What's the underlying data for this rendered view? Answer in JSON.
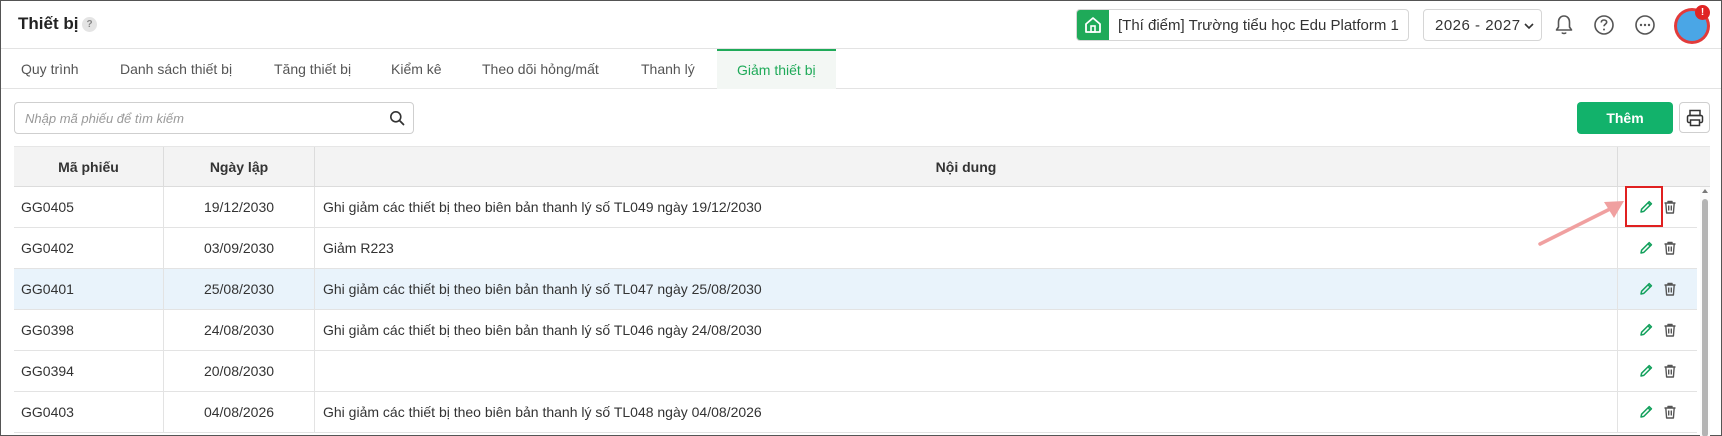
{
  "header": {
    "title": "Thiết bị",
    "help_badge": "?",
    "school_name": "[Thí điểm] Trường tiểu học Edu Platform 1",
    "school_year": "2026 - 2027",
    "notification_count": "!"
  },
  "tabs": [
    {
      "label": "Quy trình",
      "active": false
    },
    {
      "label": "Danh sách thiết bị",
      "active": false
    },
    {
      "label": "Tăng thiết bị",
      "active": false
    },
    {
      "label": "Kiểm kê",
      "active": false
    },
    {
      "label": "Theo dõi hỏng/mất",
      "active": false
    },
    {
      "label": "Thanh lý",
      "active": false
    },
    {
      "label": "Giảm thiết bị",
      "active": true
    }
  ],
  "toolbar": {
    "search_placeholder": "Nhập mã phiếu để tìm kiếm",
    "add_label": "Thêm"
  },
  "table": {
    "columns": [
      "Mã phiếu",
      "Ngày lập",
      "Nội dung"
    ],
    "rows": [
      {
        "code": "GG0405",
        "date": "19/12/2030",
        "content": "Ghi giảm các thiết bị theo biên bản thanh lý số TL049 ngày 19/12/2030"
      },
      {
        "code": "GG0402",
        "date": "03/09/2030",
        "content": "Giảm R223"
      },
      {
        "code": "GG0401",
        "date": "25/08/2030",
        "content": "Ghi giảm các thiết bị theo biên bản thanh lý số TL047 ngày 25/08/2030"
      },
      {
        "code": "GG0398",
        "date": "24/08/2030",
        "content": "Ghi giảm các thiết bị theo biên bản thanh lý số TL046 ngày 24/08/2030"
      },
      {
        "code": "GG0394",
        "date": "20/08/2030",
        "content": ""
      },
      {
        "code": "GG0403",
        "date": "04/08/2026",
        "content": "Ghi giảm các thiết bị theo biên bản thanh lý số TL048 ngày 04/08/2026"
      }
    ],
    "highlighted_row": 2
  },
  "colors": {
    "accent": "#1faa59",
    "add_button": "#12b26b",
    "highlight_row": "#e9f3fb",
    "annotation": "#e02020",
    "arrow": "#f0a0a0"
  },
  "icons": {
    "school": "home-icon",
    "year_dropdown": "chevron-down-icon",
    "notifications": "bell-icon",
    "help": "question-circle-icon",
    "more": "more-horizontal-icon",
    "search": "search-icon",
    "print": "printer-icon",
    "edit": "pencil-icon",
    "delete": "trash-icon"
  }
}
